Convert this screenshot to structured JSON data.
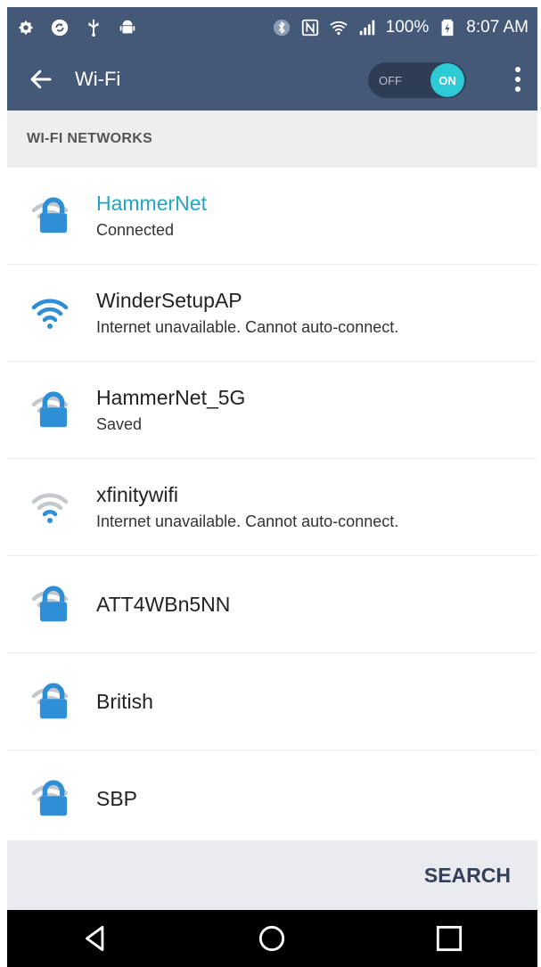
{
  "status_bar": {
    "left_icons": [
      "settings-status-icon",
      "sync-icon",
      "usb-icon",
      "android-icon"
    ],
    "right_icons": [
      "bluetooth-icon",
      "nfc-icon",
      "wifi-signal-icon",
      "cell-signal-icon"
    ],
    "battery": "100%",
    "time": "8:07 AM"
  },
  "app_bar": {
    "title": "Wi-Fi",
    "toggle_off_label": "OFF",
    "toggle_on_label": "ON"
  },
  "section": {
    "title": "WI-FI NETWORKS"
  },
  "networks": [
    {
      "name": "HammerNet",
      "status": "Connected",
      "strength": "weak",
      "secured": true,
      "connected": true
    },
    {
      "name": "WinderSetupAP",
      "status": "Internet unavailable. Cannot auto-connect.",
      "strength": "full",
      "secured": false,
      "connected": false
    },
    {
      "name": "HammerNet_5G",
      "status": "Saved",
      "strength": "weak",
      "secured": true,
      "connected": false
    },
    {
      "name": "xfinitywifi",
      "status": "Internet unavailable. Cannot auto-connect.",
      "strength": "weak",
      "secured": false,
      "connected": false
    },
    {
      "name": "ATT4WBn5NN",
      "status": "",
      "strength": "weak",
      "secured": true,
      "connected": false
    },
    {
      "name": "British",
      "status": "",
      "strength": "weak",
      "secured": true,
      "connected": false
    },
    {
      "name": "SBP",
      "status": "",
      "strength": "weak",
      "secured": true,
      "connected": false
    }
  ],
  "action_bar": {
    "search_label": "SEARCH"
  },
  "nav_bar": {
    "buttons": [
      "back-nav-icon",
      "home-nav-icon",
      "recents-nav-icon"
    ]
  },
  "colors": {
    "app_bar": "#445878",
    "accent": "#2ccbd6",
    "connected_text": "#26a5c2",
    "wifi_icon_blue": "#2f8fd6",
    "wifi_icon_gray": "#c4c8cc"
  }
}
